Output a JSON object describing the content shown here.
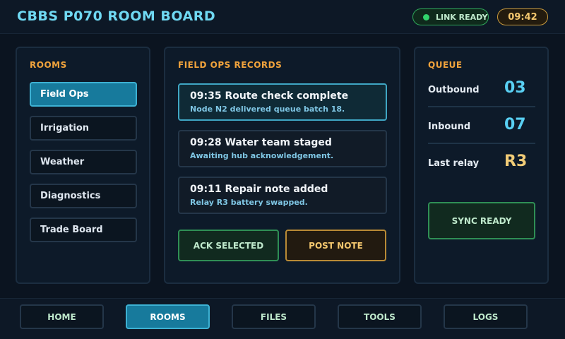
{
  "header": {
    "title": "CBBS P070 ROOM BOARD",
    "link_status": "LINK READY",
    "clock": "09:42"
  },
  "rooms": {
    "title": "ROOMS",
    "items": [
      {
        "label": "Field Ops",
        "active": true
      },
      {
        "label": "Irrigation",
        "active": false
      },
      {
        "label": "Weather",
        "active": false
      },
      {
        "label": "Diagnostics",
        "active": false
      },
      {
        "label": "Trade Board",
        "active": false
      }
    ]
  },
  "records": {
    "title": "FIELD OPS RECORDS",
    "items": [
      {
        "title": "09:35 Route check complete",
        "detail": "Node N2 delivered queue batch 18.",
        "selected": true
      },
      {
        "title": "09:28 Water team staged",
        "detail": "Awaiting hub acknowledgement.",
        "selected": false
      },
      {
        "title": "09:11 Repair note added",
        "detail": "Relay R3 battery swapped.",
        "selected": false
      }
    ],
    "ack_label": "ACK SELECTED",
    "post_label": "POST NOTE"
  },
  "queue": {
    "title": "QUEUE",
    "rows": [
      {
        "label": "Outbound",
        "value": "03"
      },
      {
        "label": "Inbound",
        "value": "07"
      },
      {
        "label": "Last relay",
        "value": "R3"
      }
    ],
    "sync_label": "SYNC READY"
  },
  "nav": {
    "items": [
      {
        "label": "HOME",
        "active": false
      },
      {
        "label": "ROOMS",
        "active": true
      },
      {
        "label": "FILES",
        "active": false
      },
      {
        "label": "TOOLS",
        "active": false
      },
      {
        "label": "LOGS",
        "active": false
      }
    ]
  },
  "colors": {
    "accent_cyan": "#6fd8f2",
    "accent_orange": "#f0a33c",
    "active_blue": "#177a9c",
    "status_green": "#31d36b",
    "gold": "#f4c76e"
  }
}
